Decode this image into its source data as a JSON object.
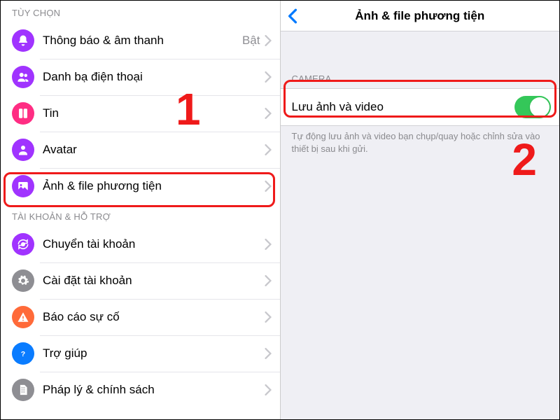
{
  "left": {
    "sections": {
      "options": {
        "header": "TÙY CHỌN",
        "items": [
          {
            "label": "Thông báo & âm thanh",
            "value": "Bật"
          },
          {
            "label": "Danh bạ điện thoại"
          },
          {
            "label": "Tin"
          },
          {
            "label": "Avatar"
          },
          {
            "label": "Ảnh & file phương tiện"
          }
        ]
      },
      "account": {
        "header": "TÀI KHOẢN & HỖ TRỢ",
        "items": [
          {
            "label": "Chuyển tài khoản"
          },
          {
            "label": "Cài đặt tài khoản"
          },
          {
            "label": "Báo cáo sự cố"
          },
          {
            "label": "Trợ giúp"
          },
          {
            "label": "Pháp lý & chính sách"
          }
        ]
      }
    }
  },
  "right": {
    "title": "Ảnh & file phương tiện",
    "camera_header": "CAMERA",
    "save_row_label": "Lưu ảnh và video",
    "save_row_on": true,
    "footnote": "Tự động lưu ảnh và video bạn chụp/quay hoặc chỉnh sửa vào thiết bị sau khi gửi."
  },
  "annotations": {
    "num1": "1",
    "num2": "2"
  }
}
